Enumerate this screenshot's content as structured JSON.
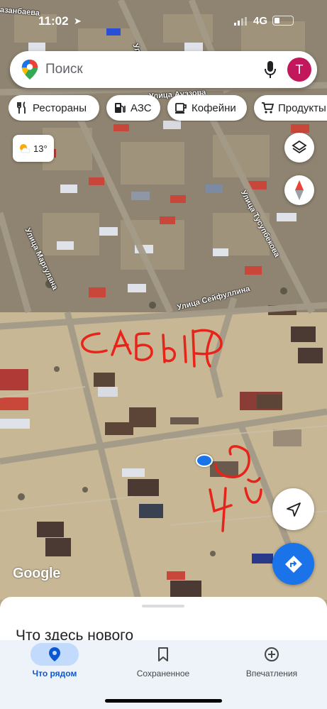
{
  "status_bar": {
    "time": "11:02",
    "network": "4G"
  },
  "search": {
    "placeholder": "Поиск",
    "avatar_letter": "Т"
  },
  "chips": [
    {
      "label": "Рестораны",
      "icon": "fork-knife-icon"
    },
    {
      "label": "АЗС",
      "icon": "gas-station-icon"
    },
    {
      "label": "Кофейни",
      "icon": "coffee-cup-icon"
    },
    {
      "label": "Продукты",
      "icon": "cart-icon"
    }
  ],
  "weather": {
    "temperature": "13°",
    "icon": "partly-cloudy-icon"
  },
  "map": {
    "streets": [
      "Улица Ауэзова",
      "Улица Тусупбекова",
      "Улица Маргулана",
      "Улица Сейфуллина",
      "Улица",
      "азанбаева"
    ],
    "handwritten_annotations": [
      "САБЫР",
      "4 Й"
    ],
    "attribution": "Google",
    "colors": {
      "annotation": "#e8231a",
      "location_dot": "#1a73e8"
    }
  },
  "map_controls": {
    "layers": "layers-icon",
    "compass": "compass-icon",
    "my_location": "navigation-arrow-icon",
    "directions": "directions-icon"
  },
  "bottom_sheet": {
    "title": "Что здесь нового"
  },
  "bottom_nav": [
    {
      "label": "Что рядом",
      "icon": "place-pin-icon",
      "active": true
    },
    {
      "label": "Сохраненное",
      "icon": "bookmark-icon",
      "active": false
    },
    {
      "label": "Впечатления",
      "icon": "add-circle-icon",
      "active": false
    }
  ],
  "accent_color": "#1a73e8"
}
